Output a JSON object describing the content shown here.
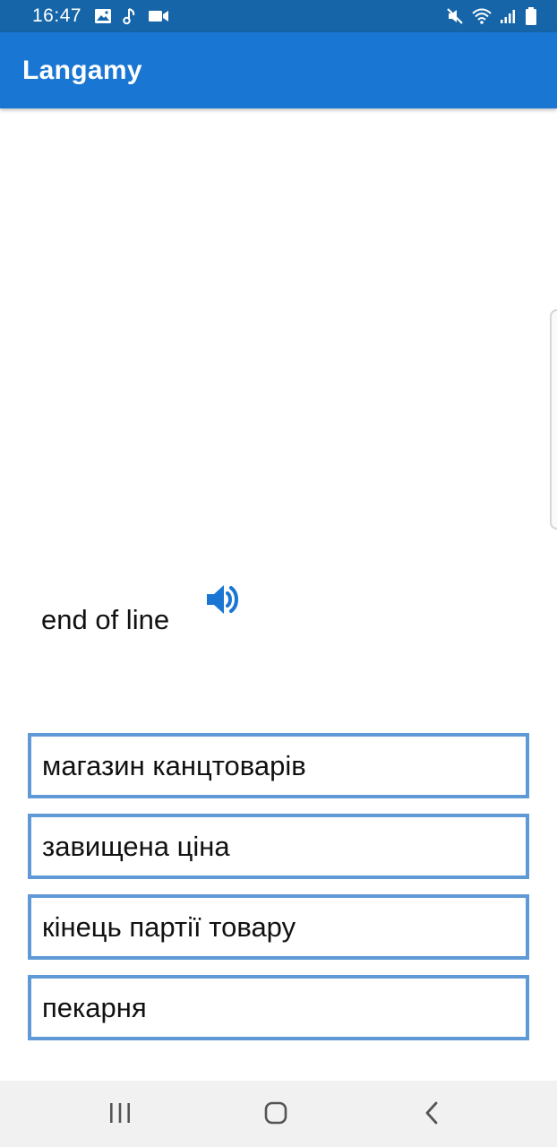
{
  "status_bar": {
    "time": "16:47",
    "left_icons": [
      "image-icon",
      "music-note-icon",
      "video-camera-icon"
    ],
    "right_icons": [
      "mute-icon",
      "wifi-icon",
      "signal-icon",
      "battery-icon"
    ]
  },
  "app_bar": {
    "title": "Langamy",
    "color": "#1976d2"
  },
  "quiz": {
    "word": "end of line",
    "speaker_icon": "speaker-icon",
    "options": [
      "магазин канцтоварів",
      "завищена ціна",
      "кінець партії товару",
      "пекарня"
    ],
    "option_border_color": "#5f9ad6"
  },
  "nav_bar": {
    "buttons": [
      "recent-apps-icon",
      "home-icon",
      "back-icon"
    ]
  }
}
